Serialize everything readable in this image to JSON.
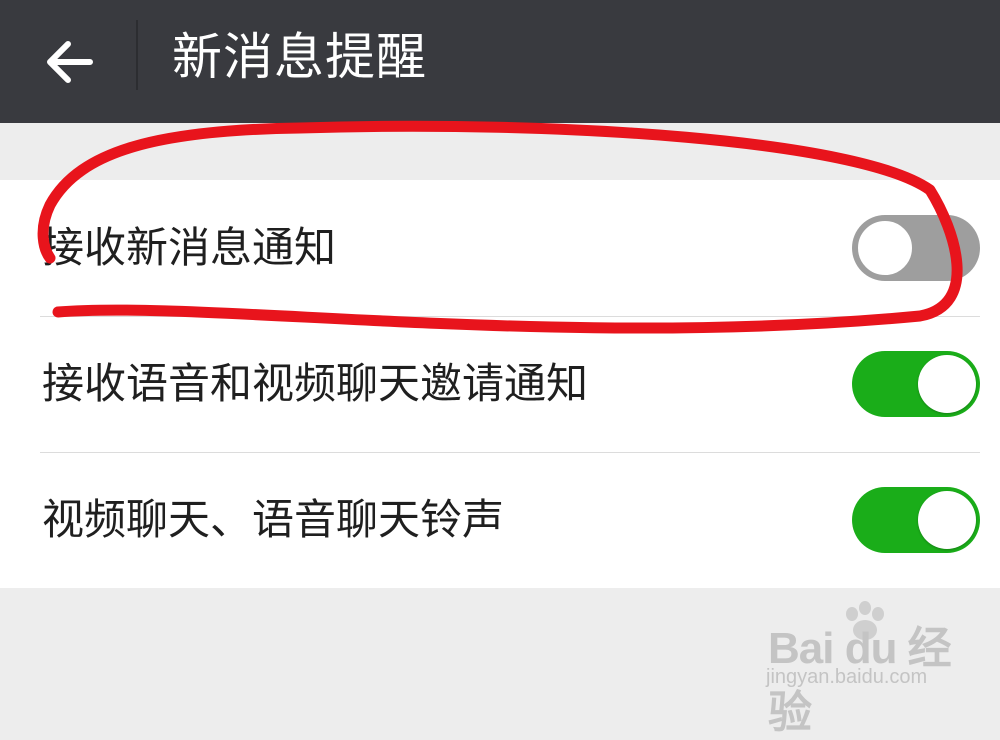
{
  "header": {
    "title": "新消息提醒",
    "back_icon": "arrow-left-icon",
    "background_color": "#393a3f"
  },
  "settings": [
    {
      "label": "接收新消息通知",
      "enabled": false
    },
    {
      "label": "接收语音和视频聊天邀请通知",
      "enabled": true
    },
    {
      "label": "视频聊天、语音聊天铃声",
      "enabled": true
    }
  ],
  "colors": {
    "toggle_on": "#1aad19",
    "toggle_off": "#9e9e9e",
    "annotation": "#e8141c"
  },
  "watermark": {
    "logo": "Bai du 经验",
    "url": "jingyan.baidu.com"
  }
}
